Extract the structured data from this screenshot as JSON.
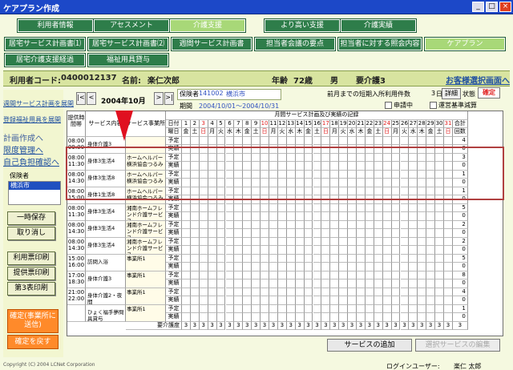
{
  "window": {
    "title": "ケアプラン作成"
  },
  "tabs_row1": [
    "利用者情報",
    "アセスメント",
    "介護支援",
    "より高い支援",
    "介護実績"
  ],
  "tabs_row2": [
    "居宅サービス計画書⑴",
    "居宅サービス計画書⑵",
    "週間サービス計画書",
    "担当者会議の要点",
    "担当者に対する照会内容",
    "ケアプラン"
  ],
  "tabs_row3": [
    "居宅介護支援経過",
    "福祉用具貸与"
  ],
  "user_info": {
    "code_label": "利用者コード:",
    "code": "0400012137",
    "name_label": "名前:",
    "name": "楽仁次郎",
    "age_label": "年齢",
    "age": "72歳",
    "sex": "男",
    "care_level": "要介護3",
    "client_select_link": "お客様選択画面へ"
  },
  "sidebar": {
    "links": [
      "週間サービス計画を展開",
      "登録福祉用具を展開",
      "計画作成へ",
      "限度管理へ",
      "自己負担確認へ"
    ],
    "insurer_label": "保険者",
    "insurer_value": "横浜市",
    "buttons": [
      "一時保存",
      "取り消し",
      "利用票印刷",
      "提供票印刷",
      "第3表印刷"
    ],
    "confirm_button": "確定(事業所に送信)",
    "revert_button": "確定を戻す"
  },
  "period_nav": {
    "month": "2004年10月",
    "first": "|<",
    "prev": "<",
    "next": ">",
    "last": ">|"
  },
  "insurance": {
    "insurer_label": "保険者",
    "insurer_no": "141002",
    "insurer_name": "横浜市",
    "period_label": "期間",
    "period": "2004/10/01～2004/10/31",
    "short_stay_label": "前月までの短期入所利用件数",
    "short_stay_days": "3",
    "short_stay_unit": "日",
    "detail_button": "詳細",
    "status_label": "状態",
    "status_button": "確定",
    "applying_label": "申請中",
    "reduction_label": "運営基準減算"
  },
  "grid": {
    "header_time": "提供時間帯",
    "header_service": "サービス内容",
    "header_provider": "サービス事業所",
    "header_monthly": "月間サービス計画及び実績の記録",
    "header_day": "日付",
    "header_weekday": "曜日",
    "header_total": "合計",
    "header_count": "回数",
    "days": [
      "1",
      "2",
      "3",
      "4",
      "5",
      "6",
      "7",
      "8",
      "9",
      "10",
      "11",
      "12",
      "13",
      "14",
      "15",
      "16",
      "17",
      "18",
      "19",
      "20",
      "21",
      "22",
      "23",
      "24",
      "25",
      "26",
      "27",
      "28",
      "29",
      "30",
      "31"
    ],
    "weekdays": [
      "金",
      "土",
      "日",
      "月",
      "火",
      "水",
      "木",
      "金",
      "土",
      "日",
      "月",
      "火",
      "水",
      "木",
      "金",
      "土",
      "日",
      "月",
      "火",
      "水",
      "木",
      "金",
      "土",
      "日",
      "月",
      "火",
      "水",
      "木",
      "金",
      "土",
      "日"
    ],
    "plan_label": "予定",
    "actual_label": "実績",
    "rows": [
      {
        "start": "08:00",
        "end": "09:00",
        "service": "身体介護3",
        "provider": "",
        "plan_total": "4",
        "actual_total": "0"
      },
      {
        "start": "08:00",
        "end": "11:30",
        "service": "身体3生活4",
        "provider": "ホームヘルパー横浜協会つるみ",
        "plan_total": "3",
        "actual_total": "0"
      },
      {
        "start": "08:00",
        "end": "14:30",
        "service": "身体3生活8",
        "provider": "ホームヘルパー横浜協会つるみ",
        "plan_total": "1",
        "actual_total": "0"
      },
      {
        "start": "08:00",
        "end": "15:00",
        "service": "身体1生活8",
        "provider": "ホームヘルパー横浜協会つるみ",
        "plan_total": "1",
        "actual_total": "0"
      },
      {
        "start": "08:00",
        "end": "11:30",
        "service": "身体3生活4",
        "provider": "湘南ホームフレンド介護サービス",
        "plan_total": "5",
        "actual_total": "0"
      },
      {
        "start": "08:00",
        "end": "14:30",
        "service": "身体3生活4",
        "provider": "湘南ホームフレンド介護サービス",
        "plan_total": "2",
        "actual_total": "0"
      },
      {
        "start": "08:00",
        "end": "14:30",
        "service": "身体3生活4",
        "provider": "湘南ホームフレンド介護サービス",
        "plan_total": "2",
        "actual_total": "0"
      },
      {
        "start": "15:00",
        "end": "16:00",
        "service": "訪問入浴",
        "provider": "事業所1",
        "plan_total": "5",
        "actual_total": "0"
      },
      {
        "start": "17:00",
        "end": "18:30",
        "service": "身体介護3",
        "provider": "事業所1",
        "plan_total": "8",
        "actual_total": "0"
      },
      {
        "start": "21:00",
        "end": "22:00",
        "service": "身体介護2・夜間",
        "provider": "事業所1",
        "plan_total": "4",
        "actual_total": "0"
      },
      {
        "start": "",
        "end": "",
        "service": "ひょく福手夢問具貸与",
        "provider": "事業所1",
        "plan_total": "1",
        "actual_total": "0"
      }
    ],
    "care_level_row_label": "要介護度",
    "care_level_value": "3"
  },
  "bottom_buttons": {
    "add_service": "サービスの追加",
    "edit_service": "選択サービスの編集"
  },
  "login": {
    "label": "ログインユーザー:",
    "user": "楽仁 太郎"
  },
  "copyright": "Copyright (C) 2004 LCNet Corporation",
  "colors": {
    "nav_green": "#2e7d4a",
    "title_blue": "#1c48c8",
    "confirm_orange": "#ff8a2a",
    "status_red": "#e02020",
    "highlight_border": "#b04040"
  }
}
